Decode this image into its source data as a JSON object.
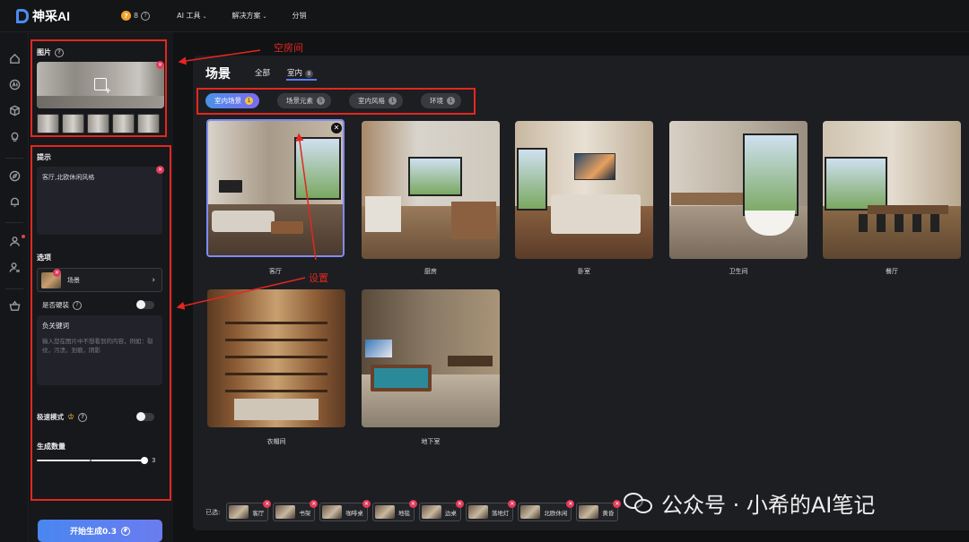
{
  "app": {
    "name": "神采AI",
    "credits": "8",
    "credit_icon": "coin-icon"
  },
  "nav": [
    {
      "label": "AI 工具",
      "has_caret": true
    },
    {
      "label": "解决方案",
      "has_caret": true
    },
    {
      "label": "分销",
      "has_caret": false
    }
  ],
  "rail_icons": [
    "home-icon",
    "ai-icon",
    "cube-icon",
    "bulb-icon",
    "compass-icon",
    "bell-icon",
    "user-icon",
    "user-share-icon",
    "basket-icon"
  ],
  "left_panel": {
    "image_title": "图片",
    "prompt_title": "提示",
    "prompt_text": "客厅,北欧休闲风格",
    "options_title": "选项",
    "scene_select": "场景",
    "hard_decor_label": "是否硬装",
    "negative_title": "负关键词",
    "negative_placeholder": "输入您在图片中不想看到的内容，例如：裂纹，污渍，划痕，阴影",
    "fast_mode_label": "极速模式",
    "count_title": "生成数量",
    "count_value": "3",
    "count_fraction": 1.0,
    "generate_button": "开始生成0.3"
  },
  "annotations": {
    "empty_room": "空房间",
    "settings": "设置"
  },
  "main": {
    "title": "场景",
    "tabs": [
      {
        "label": "全部",
        "count": ""
      },
      {
        "label": "室内",
        "count": "8"
      }
    ],
    "chips": [
      {
        "label": "室内场景",
        "count": "1",
        "active": true
      },
      {
        "label": "场景元素",
        "count": "5",
        "active": false
      },
      {
        "label": "室内风格",
        "count": "1",
        "active": false
      },
      {
        "label": "环境",
        "count": "1",
        "active": false
      }
    ],
    "cards": [
      {
        "label": "客厅",
        "selected": true
      },
      {
        "label": "厨房",
        "selected": false
      },
      {
        "label": "卧室",
        "selected": false
      },
      {
        "label": "卫生间",
        "selected": false
      },
      {
        "label": "餐厅",
        "selected": false
      },
      {
        "label": "衣帽间",
        "selected": false
      },
      {
        "label": "地下室",
        "selected": false
      }
    ],
    "selected_label": "已选:",
    "selected_items": [
      "客厅",
      "书架",
      "咖啡桌",
      "地毯",
      "边桌",
      "落地灯",
      "北欧休闲",
      "黄昏"
    ]
  },
  "watermark": "公众号 · 小希的AI笔记",
  "colors": {
    "accent": "#5b7cf0",
    "annotation_red": "#e3271f",
    "remove_badge": "#e33a5b"
  }
}
